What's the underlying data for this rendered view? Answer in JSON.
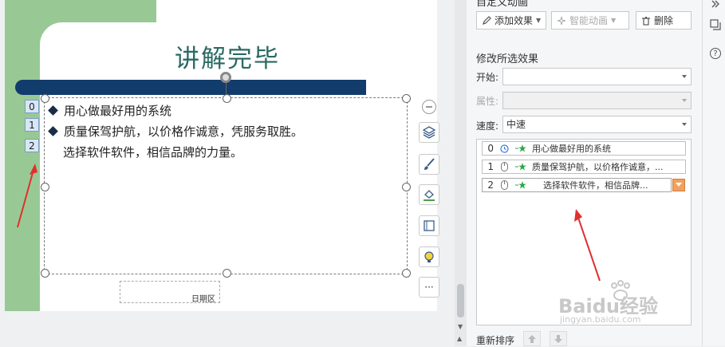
{
  "slide": {
    "title": "讲解完毕",
    "bullets": [
      "用心做最好用的系统",
      "质量保驾护航，以价格作诚意，凭服务取胜。"
    ],
    "plain_line": "选择软件软件，相信品牌的力量。",
    "anim_tags": [
      "0",
      "1",
      "2"
    ],
    "date_placeholder": "日期区"
  },
  "float_toolbar": {
    "collapse_icon": "minus-circle-icon",
    "buttons": [
      "layers-icon",
      "brush-icon",
      "fill-icon",
      "frame-icon",
      "bulb-icon",
      "more-icon"
    ],
    "more_label": "···"
  },
  "panel": {
    "title": "自定义动画",
    "toolbar": {
      "add_effect": "添加效果",
      "smart_anim": "智能动画",
      "delete": "删除"
    },
    "modify_section": "修改所选效果",
    "start_label": "开始:",
    "start_value": "",
    "property_label": "属性:",
    "property_value": "",
    "speed_label": "速度:",
    "speed_value": "中速",
    "anim_items": [
      {
        "index": "0",
        "trigger": "clock-icon",
        "label": "用心做最好用的系统"
      },
      {
        "index": "1",
        "trigger": "mouse-icon",
        "label": "质量保驾护航，以价格作诚意，..."
      },
      {
        "index": "2",
        "trigger": "mouse-icon",
        "label": "选择软件软件，相信品牌..."
      }
    ],
    "reorder_label": "重新排序"
  },
  "side_strip": {
    "icons": [
      "expand-icon",
      "copy-icon",
      "help-icon"
    ],
    "help_glyph": "?"
  },
  "colors": {
    "accent_green": "#98c995",
    "title_color": "#2a6a63",
    "bar_navy": "#123c6b",
    "menu_orange": "#f0a060",
    "arrow_red": "#e03030"
  },
  "watermark": {
    "brand": "Baidu经验",
    "url": "jingyan.baidu.com"
  }
}
